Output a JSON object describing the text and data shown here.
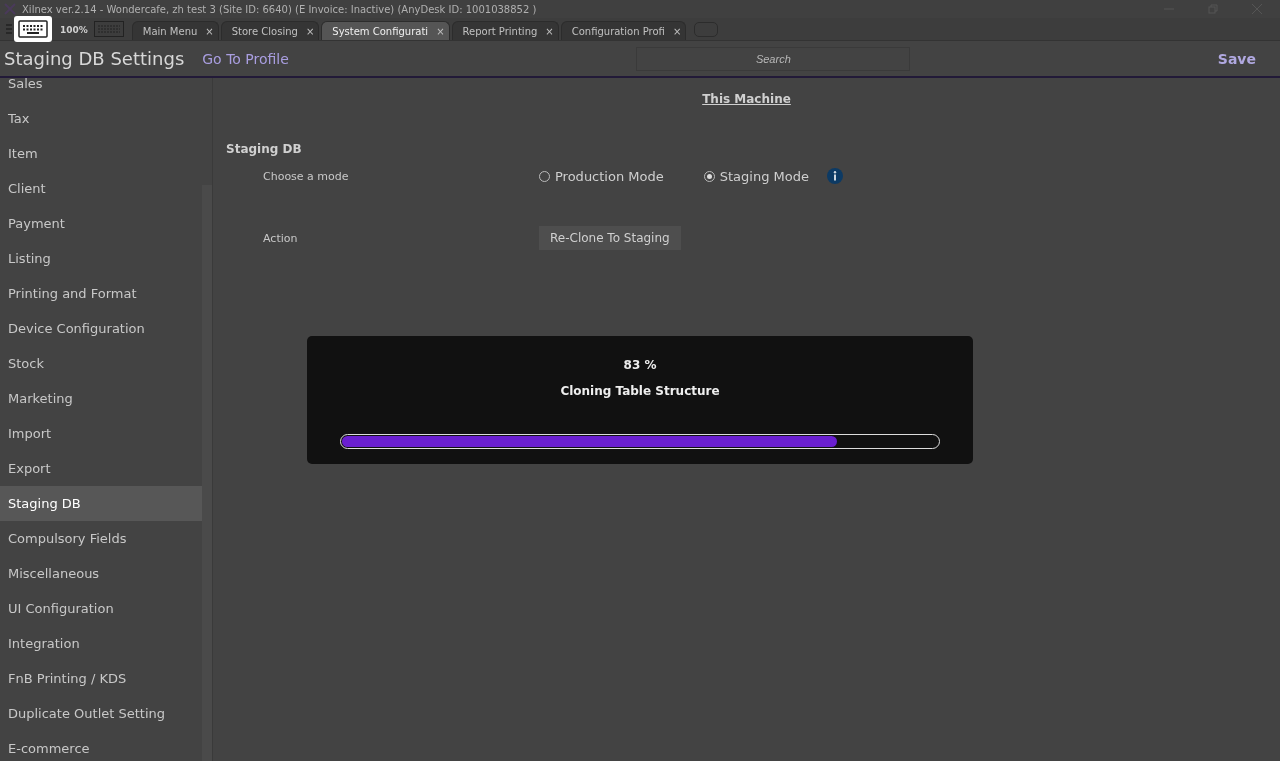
{
  "window": {
    "title": "Xilnex ver.2.14 -  Wondercafe, zh test 3  (Site ID: 6640)  (E Invoice: Inactive) (AnyDesk ID: 1001038852 )"
  },
  "toolbar": {
    "zoom": "100%"
  },
  "tabs": [
    {
      "label": "Main Menu",
      "close": "×",
      "selected": false
    },
    {
      "label": "Store Closing",
      "close": "×",
      "selected": false
    },
    {
      "label": "System Configurati",
      "close": "×",
      "selected": true
    },
    {
      "label": "Report Printing",
      "close": "×",
      "selected": false
    },
    {
      "label": "Configuration Profi",
      "close": "×",
      "selected": false
    }
  ],
  "header": {
    "title": "Staging DB Settings",
    "profile_link": "Go To Profile",
    "search": {
      "placeholder": "Search"
    },
    "save": "Save"
  },
  "sidebar": {
    "items": [
      {
        "label": "Sales",
        "selected": false
      },
      {
        "label": "Tax",
        "selected": false
      },
      {
        "label": "Item",
        "selected": false
      },
      {
        "label": "Client",
        "selected": false
      },
      {
        "label": "Payment",
        "selected": false
      },
      {
        "label": "Listing",
        "selected": false
      },
      {
        "label": "Printing and Format",
        "selected": false
      },
      {
        "label": "Device Configuration",
        "selected": false
      },
      {
        "label": "Stock",
        "selected": false
      },
      {
        "label": "Marketing",
        "selected": false
      },
      {
        "label": "Import",
        "selected": false
      },
      {
        "label": "Export",
        "selected": false
      },
      {
        "label": "Staging DB",
        "selected": true
      },
      {
        "label": "Compulsory Fields",
        "selected": false
      },
      {
        "label": "Miscellaneous",
        "selected": false
      },
      {
        "label": "UI Configuration",
        "selected": false
      },
      {
        "label": "Integration",
        "selected": false
      },
      {
        "label": "FnB Printing / KDS",
        "selected": false
      },
      {
        "label": "Duplicate Outlet Setting",
        "selected": false
      },
      {
        "label": "E-commerce",
        "selected": false
      }
    ]
  },
  "content": {
    "scope_link": "This Machine",
    "section": "Staging DB",
    "mode_label": "Choose a mode",
    "modes": [
      {
        "label": "Production Mode",
        "selected": false
      },
      {
        "label": "Staging Mode",
        "selected": true
      }
    ],
    "action_label": "Action",
    "action_button": "Re-Clone To Staging"
  },
  "progress": {
    "percent": "83 %",
    "message": "Cloning Table Structure",
    "level": 0.83
  }
}
